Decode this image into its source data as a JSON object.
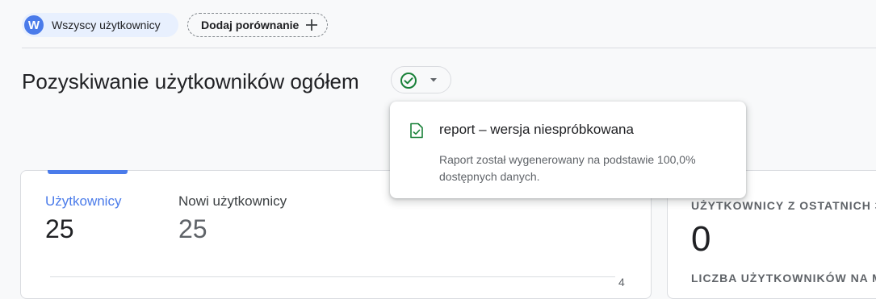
{
  "filters": {
    "all_users_avatar": "W",
    "all_users_label": "Wszyscy użytkownicy",
    "add_comparison_label": "Dodaj porównanie"
  },
  "header": {
    "title": "Pozyskiwanie użytkowników ogółem"
  },
  "status_popup": {
    "title": "report – wersja niespróbkowana",
    "description": "Raport został wygenerowany na podstawie 100,0% dostępnych danych."
  },
  "metrics_card": {
    "metrics": [
      {
        "label": "Użytkownicy",
        "value": "25",
        "selected": true
      },
      {
        "label": "Nowi użytkownicy",
        "value": "25",
        "selected": false
      }
    ],
    "axis_tick": "4"
  },
  "realtime_card": {
    "heading": "UŻYTKOWNICY Z OSTATNICH 3",
    "value": "0",
    "subheading": "LICZBA UŻYTKOWNIKÓW NA M"
  },
  "colors": {
    "accent": "#4a7bea",
    "success": "#188038",
    "text_primary": "#202124",
    "text_secondary": "#5f6368"
  },
  "icons": {
    "add": "plus-icon",
    "status": "check-circle-icon",
    "dropdown": "caret-down-icon",
    "doc": "verified-doc-icon"
  }
}
